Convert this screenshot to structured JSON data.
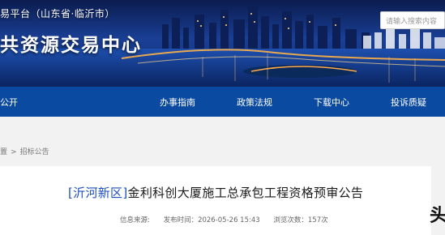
{
  "header": {
    "subtitle": "易平台（山东省·临沂市）",
    "title": "共资源交易中心",
    "search_placeholder": "请输入搜索内容"
  },
  "nav": {
    "items": [
      {
        "label": "公开"
      },
      {
        "label": "办事指南"
      },
      {
        "label": "政策法规"
      },
      {
        "label": "下载中心"
      },
      {
        "label": "投诉质疑"
      }
    ]
  },
  "breadcrumb": {
    "first": "置",
    "separator": ">",
    "current": "招标公告"
  },
  "article": {
    "district": "[沂河新区]",
    "title": "金利科创大厦施工总承包工程资格预审公告",
    "meta": {
      "source": "信息来源:",
      "published": "发布时间：2026-05-26 15:43",
      "views": "浏览次数：157次"
    }
  },
  "overlay": {
    "corner_char": "头"
  },
  "colors": {
    "nav_bg": "#0a4aa0",
    "district": "#1c4fc0",
    "banner_dark": "#0a1a4a"
  }
}
